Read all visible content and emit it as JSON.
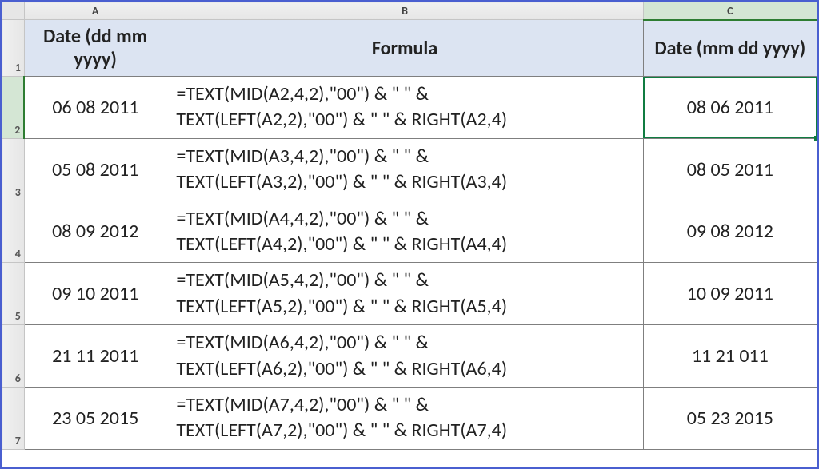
{
  "columns": [
    {
      "letter": "A",
      "header": "Date (dd mm yyyy)"
    },
    {
      "letter": "B",
      "header": "Formula"
    },
    {
      "letter": "C",
      "header": "Date (mm dd yyyy)"
    }
  ],
  "rows": [
    {
      "row_label": "2",
      "a": "06 08 2011",
      "b": "=TEXT(MID(A2,4,2),\"00\") & \" \" & TEXT(LEFT(A2,2),\"00\") & \" \" & RIGHT(A2,4)",
      "c": "08 06 2011",
      "active": true
    },
    {
      "row_label": "3",
      "a": "05 08 2011",
      "b": "=TEXT(MID(A3,4,2),\"00\") & \" \" & TEXT(LEFT(A3,2),\"00\") & \" \" & RIGHT(A3,4)",
      "c": "08 05 2011"
    },
    {
      "row_label": "4",
      "a": "08 09 2012",
      "b": "=TEXT(MID(A4,4,2),\"00\") & \" \" & TEXT(LEFT(A4,2),\"00\") & \" \" & RIGHT(A4,4)",
      "c": "09 08 2012"
    },
    {
      "row_label": "5",
      "a": "09 10 2011",
      "b": "=TEXT(MID(A5,4,2),\"00\") & \" \" & TEXT(LEFT(A5,2),\"00\") & \" \" & RIGHT(A5,4)",
      "c": "10 09 2011"
    },
    {
      "row_label": "6",
      "a": "21 11 2011",
      "b": "=TEXT(MID(A6,4,2),\"00\") & \" \" & TEXT(LEFT(A6,2),\"00\") & \" \" & RIGHT(A6,4)",
      "c": "11 21 011"
    },
    {
      "row_label": "7",
      "a": "23 05 2015",
      "b": "=TEXT(MID(A7,4,2),\"00\") & \" \" & TEXT(LEFT(A7,2),\"00\") & \" \" & RIGHT(A7,4)",
      "c": "05 23 2015"
    }
  ],
  "header_row_label": "1"
}
